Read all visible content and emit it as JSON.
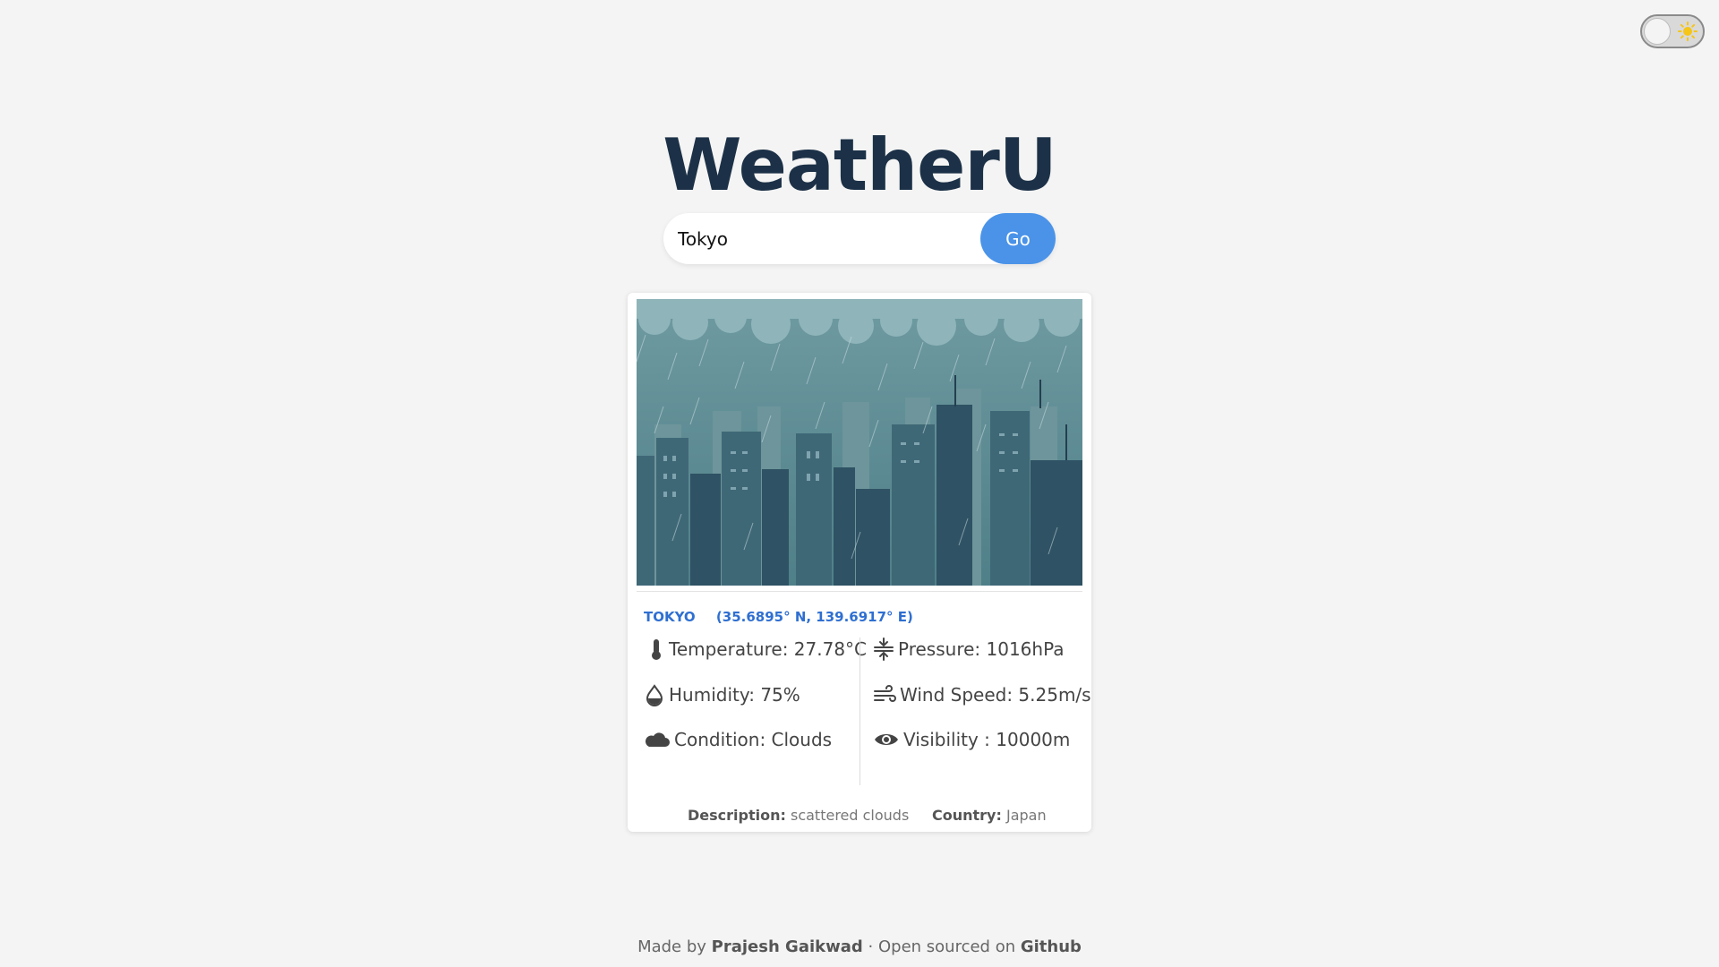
{
  "app": {
    "title": "WeatherU"
  },
  "theme_toggle": {
    "icon": "sun-icon",
    "state": "light"
  },
  "search": {
    "value": "Tokyo",
    "button_label": "Go"
  },
  "result": {
    "city": "TOKYO",
    "coordinates": "(35.6895° N, 139.6917° E)",
    "stats": {
      "temperature": "Temperature: 27.78°C",
      "humidity": "Humidity: 75%",
      "condition": "Condition: Clouds",
      "pressure": "Pressure: 1016hPa",
      "wind_speed": "Wind Speed: 5.25m/s",
      "visibility": "Visibility : 10000m"
    },
    "description_label": "Description:",
    "description_value": "scattered clouds",
    "country_label": "Country:",
    "country_value": "Japan"
  },
  "footer": {
    "made_by_prefix": "Made by",
    "author": "Prajesh Gaikwad",
    "separator": "· Open sourced on",
    "repo_link": "Github"
  },
  "colors": {
    "accent": "#4a93e8",
    "title": "#1c3147",
    "location": "#2f6fd1",
    "background": "#f4f4f4"
  }
}
